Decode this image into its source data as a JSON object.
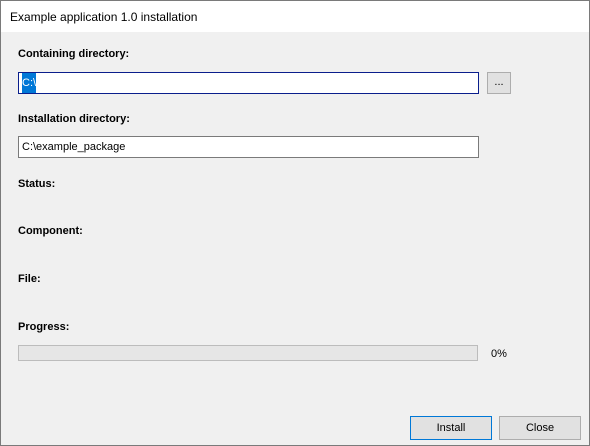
{
  "window": {
    "title": "Example application 1.0 installation"
  },
  "containing_directory": {
    "label": "Containing directory:",
    "value": "C:\\",
    "browse_label": "..."
  },
  "installation_directory": {
    "label": "Installation directory:",
    "value": "C:\\example_package"
  },
  "status": {
    "label": "Status:"
  },
  "component": {
    "label": "Component:"
  },
  "file": {
    "label": "File:"
  },
  "progress": {
    "label": "Progress:",
    "value": 0,
    "percent_text": "0%"
  },
  "buttons": {
    "install": "Install",
    "close": "Close"
  },
  "colors": {
    "selection": "#0078d7",
    "focus_border": "#0a1e8c",
    "button_face": "#e1e1e1",
    "window_bg": "#f0f0f0"
  }
}
